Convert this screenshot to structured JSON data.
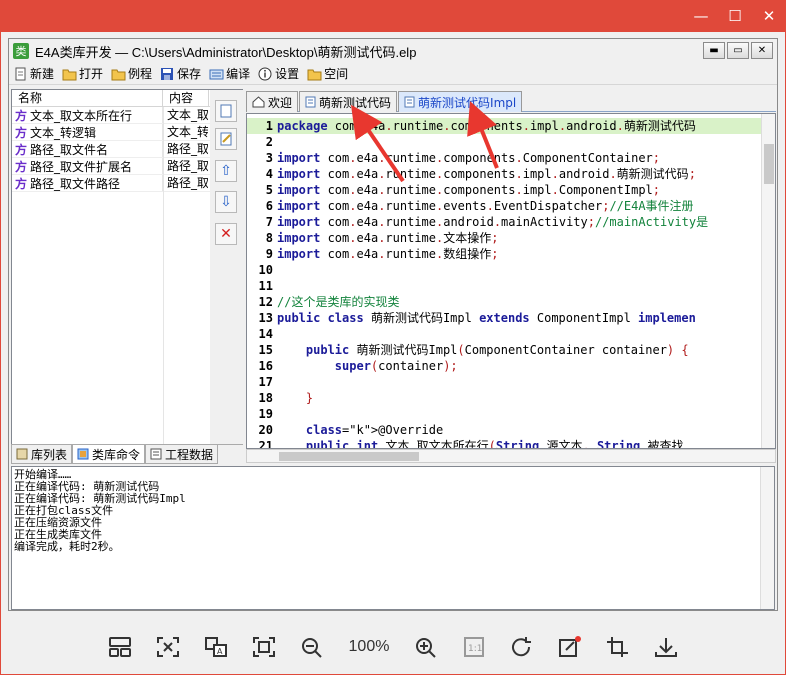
{
  "window": {
    "title": "E4A类库开发 — C:\\Users\\Administrator\\Desktop\\萌新测试代码.elp",
    "app_icon_char": "类",
    "controls": [
      "—",
      "☐",
      "✕"
    ]
  },
  "toolbar": {
    "items": [
      {
        "label": "新建",
        "icon": "new-file-icon"
      },
      {
        "label": "打开",
        "icon": "open-folder-icon"
      },
      {
        "label": "例程",
        "icon": "examples-folder-icon"
      },
      {
        "label": "保存",
        "icon": "save-disk-icon"
      },
      {
        "label": "编译",
        "icon": "compile-icon"
      },
      {
        "label": "设置",
        "icon": "info-icon"
      },
      {
        "label": "空间",
        "icon": "workspace-folder-icon"
      }
    ]
  },
  "left_panel": {
    "headers": [
      "名称",
      "内容"
    ],
    "rows": [
      {
        "prefix": "方",
        "name": "文本_取文本所在行",
        "content": "文本_取"
      },
      {
        "prefix": "方",
        "name": "文本_转逻辑",
        "content": "文本_转"
      },
      {
        "prefix": "方",
        "name": "路径_取文件名",
        "content": "路径_取"
      },
      {
        "prefix": "方",
        "name": "路径_取文件扩展名",
        "content": "路径_取"
      },
      {
        "prefix": "方",
        "name": "路径_取文件路径",
        "content": "路径_取"
      }
    ],
    "tabs": [
      {
        "label": "库列表",
        "active": false
      },
      {
        "label": "类库命令",
        "active": true
      },
      {
        "label": "工程数据",
        "active": false
      }
    ]
  },
  "editor": {
    "tabs": [
      {
        "label": "欢迎",
        "active": false
      },
      {
        "label": "萌新测试代码",
        "active": false
      },
      {
        "label": "萌新测试代码Impl",
        "active": true
      }
    ],
    "lines": [
      {
        "n": "1",
        "text": "package com.e4a.runtime.components.impl.android.萌新测试代码"
      },
      {
        "n": "2",
        "text": ""
      },
      {
        "n": "3",
        "text": "import com.e4a.runtime.components.ComponentContainer;"
      },
      {
        "n": "4",
        "text": "import com.e4a.runtime.components.impl.android.萌新测试代码;"
      },
      {
        "n": "5",
        "text": "import com.e4a.runtime.components.impl.ComponentImpl;"
      },
      {
        "n": "6",
        "text": "import com.e4a.runtime.events.EventDispatcher;//E4A事件注册"
      },
      {
        "n": "7",
        "text": "import com.e4a.runtime.android.mainActivity;//mainActivity是"
      },
      {
        "n": "8",
        "text": "import com.e4a.runtime.文本操作;"
      },
      {
        "n": "9",
        "text": "import com.e4a.runtime.数组操作;"
      },
      {
        "n": "10",
        "text": ""
      },
      {
        "n": "11",
        "text": ""
      },
      {
        "n": "12",
        "text": "//这个是类库的实现类"
      },
      {
        "n": "13",
        "text": "public class 萌新测试代码Impl extends ComponentImpl implemen"
      },
      {
        "n": "14",
        "text": ""
      },
      {
        "n": "15",
        "text": "    public 萌新测试代码Impl(ComponentContainer container) {"
      },
      {
        "n": "16",
        "text": "        super(container);"
      },
      {
        "n": "17",
        "text": ""
      },
      {
        "n": "18",
        "text": "    }"
      },
      {
        "n": "19",
        "text": ""
      },
      {
        "n": "20",
        "text": "    @Override"
      },
      {
        "n": "21",
        "text": "    public int 文本_取文本所在行(String 源文本, String 被查找"
      }
    ]
  },
  "output": {
    "lines": [
      "开始编译……",
      "正在编译代码: 萌新测试代码",
      "正在编译代码: 萌新测试代码Impl",
      "正在打包class文件",
      "正在压缩资源文件",
      "正在生成类库文件",
      "编译完成，耗时2秒。"
    ]
  },
  "viewer": {
    "zoom": "100%",
    "tools": [
      "layout-icon",
      "crop-fit-icon",
      "translate-icon",
      "fullscreen-icon",
      "zoom-out-icon",
      "zoom-in-icon",
      "actual-size-icon",
      "rotate-icon",
      "edit-icon",
      "crop-icon",
      "download-icon"
    ]
  },
  "colors": {
    "viewer_accent": "#e0493a",
    "keyword": "#1b1b99",
    "comment": "#13833c",
    "highlight_line": "#d9f2c8",
    "annotation_arrow": "#e8372f"
  }
}
